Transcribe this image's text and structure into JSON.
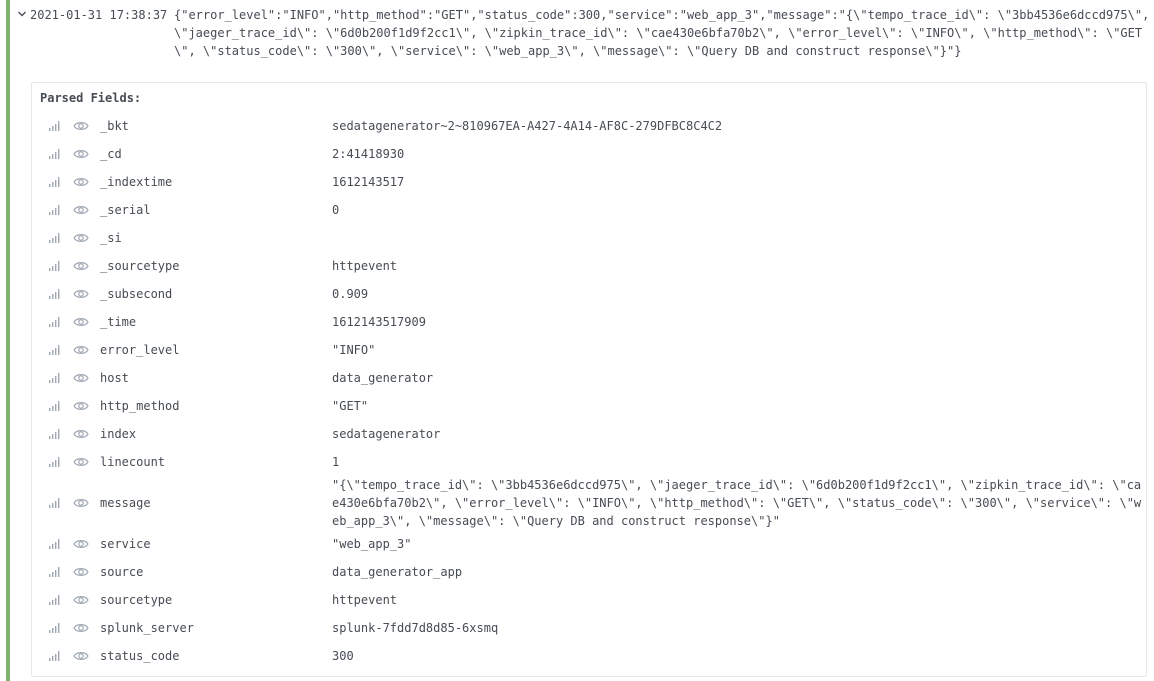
{
  "colors": {
    "level_bar": "#7eb26d",
    "text": "#464c54",
    "icon": "#9fa7b3",
    "border": "#e4e7ed"
  },
  "log": {
    "timestamp": "2021-01-31 17:38:37",
    "raw": "{\"error_level\":\"INFO\",\"http_method\":\"GET\",\"status_code\":300,\"service\":\"web_app_3\",\"message\":\"{\\\"tempo_trace_id\\\": \\\"3bb4536e6dccd975\\\", \\\"jaeger_trace_id\\\": \\\"6d0b200f1d9f2cc1\\\", \\\"zipkin_trace_id\\\": \\\"cae430e6bfa70b2\\\", \\\"error_level\\\": \\\"INFO\\\", \\\"http_method\\\": \\\"GET\\\", \\\"status_code\\\": \\\"300\\\", \\\"service\\\": \\\"web_app_3\\\", \\\"message\\\": \\\"Query DB and construct response\\\"}\"}"
  },
  "details": {
    "title": "Parsed Fields:",
    "fields": [
      {
        "name": "_bkt",
        "value": "sedatagenerator~2~810967EA-A427-4A14-AF8C-279DFBC8C4C2"
      },
      {
        "name": "_cd",
        "value": "2:41418930"
      },
      {
        "name": "_indextime",
        "value": "1612143517"
      },
      {
        "name": "_serial",
        "value": "0"
      },
      {
        "name": "_si",
        "value": ""
      },
      {
        "name": "_sourcetype",
        "value": "httpevent"
      },
      {
        "name": "_subsecond",
        "value": "0.909"
      },
      {
        "name": "_time",
        "value": "1612143517909"
      },
      {
        "name": "error_level",
        "value": "\"INFO\""
      },
      {
        "name": "host",
        "value": "data_generator"
      },
      {
        "name": "http_method",
        "value": "\"GET\""
      },
      {
        "name": "index",
        "value": "sedatagenerator"
      },
      {
        "name": "linecount",
        "value": "1"
      },
      {
        "name": "message",
        "value": "\"{\\\"tempo_trace_id\\\": \\\"3bb4536e6dccd975\\\", \\\"jaeger_trace_id\\\": \\\"6d0b200f1d9f2cc1\\\", \\\"zipkin_trace_id\\\": \\\"cae430e6bfa70b2\\\", \\\"error_level\\\": \\\"INFO\\\", \\\"http_method\\\": \\\"GET\\\", \\\"status_code\\\": \\\"300\\\", \\\"service\\\": \\\"web_app_3\\\", \\\"message\\\": \\\"Query DB and construct response\\\"}\""
      },
      {
        "name": "service",
        "value": "\"web_app_3\""
      },
      {
        "name": "source",
        "value": "data_generator_app"
      },
      {
        "name": "sourcetype",
        "value": "httpevent"
      },
      {
        "name": "splunk_server",
        "value": "splunk-7fdd7d8d85-6xsmq"
      },
      {
        "name": "status_code",
        "value": "300"
      }
    ]
  }
}
